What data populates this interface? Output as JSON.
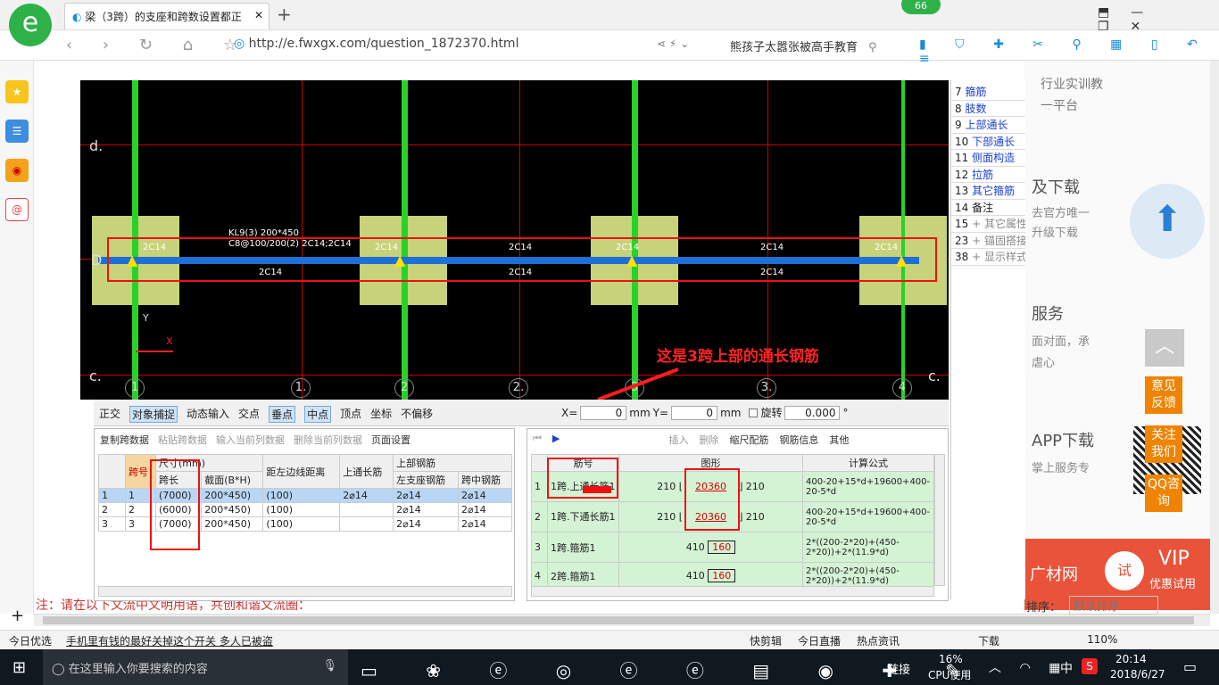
{
  "browser": {
    "tab_title": "梁（3跨）的支座和跨数设置都正",
    "badge": "66",
    "url": "http://e.fwxgx.com/question_1872370.html",
    "search_text": "熊孩子太嚣张被高手教育",
    "add_tab": "+"
  },
  "cad": {
    "beam_label": "KL9(3) 200*450",
    "beam_label2": "C8@100/200(2) 2C14;2C14",
    "rebar": "2C14",
    "axis_d": "d.",
    "axis_D": "D",
    "axis_c": "c.",
    "axis_c2": "c.",
    "axis_y": "Y",
    "axis_x": "X",
    "grid_nums": [
      "1",
      "1.",
      "2",
      "2.",
      "3",
      "3.",
      "4"
    ],
    "annotation": "这是3跨上部的通长钢筋"
  },
  "toolbar": {
    "items": [
      "正交",
      "对象捕捉",
      "动态输入",
      "交点",
      "垂点",
      "中点",
      "顶点",
      "坐标",
      "不偏移"
    ],
    "x_label": "X=",
    "x_value": "0",
    "mm": "mm",
    "y_label": "Y=",
    "y_value": "0",
    "mm2": "mm",
    "rotate_label": "旋转",
    "rotate_value": "0.000",
    "deg": "°"
  },
  "left_panel": {
    "actions": [
      "复制跨数据",
      "粘贴跨数据",
      "输入当前列数据",
      "删除当前列数据",
      "页面设置"
    ],
    "headers": [
      "跨号",
      "尺寸(mm)",
      "跨长",
      "截面(B*H)",
      "距左边线距离",
      "上通长筋",
      "上部钢筋",
      "左支座钢筋",
      "跨中钢筋"
    ],
    "rows": [
      {
        "idx": "1",
        "span": "1",
        "len": "(7000)",
        "sec": "200*450)",
        "dist": "(100)",
        "top": "2⌀14",
        "left": "2⌀14",
        "mid": "2⌀14"
      },
      {
        "idx": "2",
        "span": "2",
        "len": "(6000)",
        "sec": "200*450)",
        "dist": "(100)",
        "top": "",
        "left": "2⌀14",
        "mid": "2⌀14"
      },
      {
        "idx": "3",
        "span": "3",
        "len": "(7000)",
        "sec": "200*450)",
        "dist": "(100)",
        "top": "",
        "left": "2⌀14",
        "mid": "2⌀14"
      }
    ]
  },
  "right_panel": {
    "actions": [
      "插入",
      "删除",
      "缩尺配筋",
      "钢筋信息",
      "其他"
    ],
    "headers": [
      "筋号",
      "图形",
      "计算公式"
    ],
    "rows": [
      {
        "idx": "1",
        "name": "1跨.上通长筋1",
        "left": "210",
        "mid": "20360",
        "right": "210",
        "formula": "400-20+15*d+19600+400-20-5*d"
      },
      {
        "idx": "2",
        "name": "1跨.下通长筋1",
        "left": "210",
        "mid": "20360",
        "right": "210",
        "formula": "400-20+15*d+19600+400-20-5*d"
      },
      {
        "idx": "3",
        "name": "1跨.箍筋1",
        "left": "410",
        "mid": "160",
        "right": "",
        "formula": "2*((200-2*20)+(450-2*20))+2*(11.9*d)"
      },
      {
        "idx": "4",
        "name": "2跨.箍筋1",
        "left": "410",
        "mid": "160",
        "right": "",
        "formula": "2*((200-2*20)+(450-2*20))+2*(11.9*d)"
      }
    ]
  },
  "side_list": [
    {
      "n": "7",
      "t": "箍筋"
    },
    {
      "n": "8",
      "t": "肢数"
    },
    {
      "n": "9",
      "t": "上部通长"
    },
    {
      "n": "10",
      "t": "下部通长"
    },
    {
      "n": "11",
      "t": "侧面构造"
    },
    {
      "n": "12",
      "t": "拉筋"
    },
    {
      "n": "13",
      "t": "其它箍筋"
    },
    {
      "n": "14",
      "t": "备注"
    },
    {
      "n": "15",
      "t": "+ 其它属性"
    },
    {
      "n": "23",
      "t": "+ 锚固搭接"
    },
    {
      "n": "38",
      "t": "+ 显示样式"
    }
  ],
  "page_bg": {
    "texts": [
      "行业实训教",
      "一平台",
      "及下载",
      "去官方唯一",
      "升级下载",
      "服务",
      "面对面，承",
      "虐心",
      "APP下载",
      "掌上服务专",
      "广材网",
      "VIP",
      "优惠试用",
      "试"
    ],
    "bottom_text": "注：请在以下文流中文明用语，共创和谐文流圈：",
    "sort_label": "排序：",
    "sort_value": "默认排序"
  },
  "float_buttons": [
    "意见反馈",
    "关注我们",
    "QQ咨询"
  ],
  "status": {
    "items": [
      "今日优选",
      "手机里有钱的最好关掉这个开关 多人已被盗",
      "快剪辑",
      "今日直播",
      "热点资讯",
      "下载",
      "110%"
    ]
  },
  "taskbar": {
    "search_placeholder": "在这里输入你要搜索的内容",
    "link": "链接",
    "cpu": "16%",
    "cpu_label": "CPU使用",
    "ime": "中",
    "time": "20:14",
    "date": "2018/6/27"
  },
  "colors": {
    "accent": "#ee1111",
    "grid": "#cc0000",
    "beam": "#1e6fd6",
    "column": "#c8d27a",
    "green": "#27d327",
    "orange": "#f08300"
  }
}
